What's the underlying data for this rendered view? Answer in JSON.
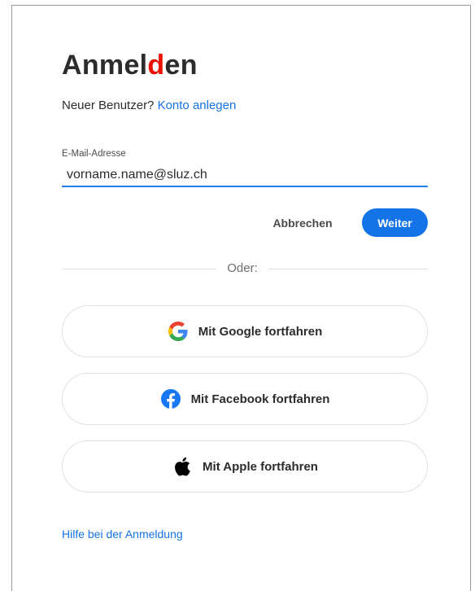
{
  "title": {
    "text_main": "Anmel",
    "text_accent": "d",
    "text_end": "en"
  },
  "signup": {
    "prompt": "Neuer Benutzer?",
    "link": "Konto anlegen"
  },
  "email": {
    "label": "E-Mail-Adresse",
    "value": "vorname.name@sluz.ch"
  },
  "actions": {
    "cancel": "Abbrechen",
    "continue": "Weiter"
  },
  "divider": {
    "text": "Oder:"
  },
  "social": {
    "google": {
      "label": "Mit Google fortfahren",
      "icon": "google-icon"
    },
    "facebook": {
      "label": "Mit Facebook fortfahren",
      "icon": "facebook-icon"
    },
    "apple": {
      "label": "Mit Apple fortfahren",
      "icon": "apple-icon"
    }
  },
  "help": {
    "link": "Hilfe bei der Anmeldung"
  },
  "colors": {
    "accent_blue": "#1473e6",
    "input_underline": "#2680eb",
    "title_dot": "#eb1000",
    "text": "#2c2c2c",
    "border": "#e1e1e1"
  }
}
